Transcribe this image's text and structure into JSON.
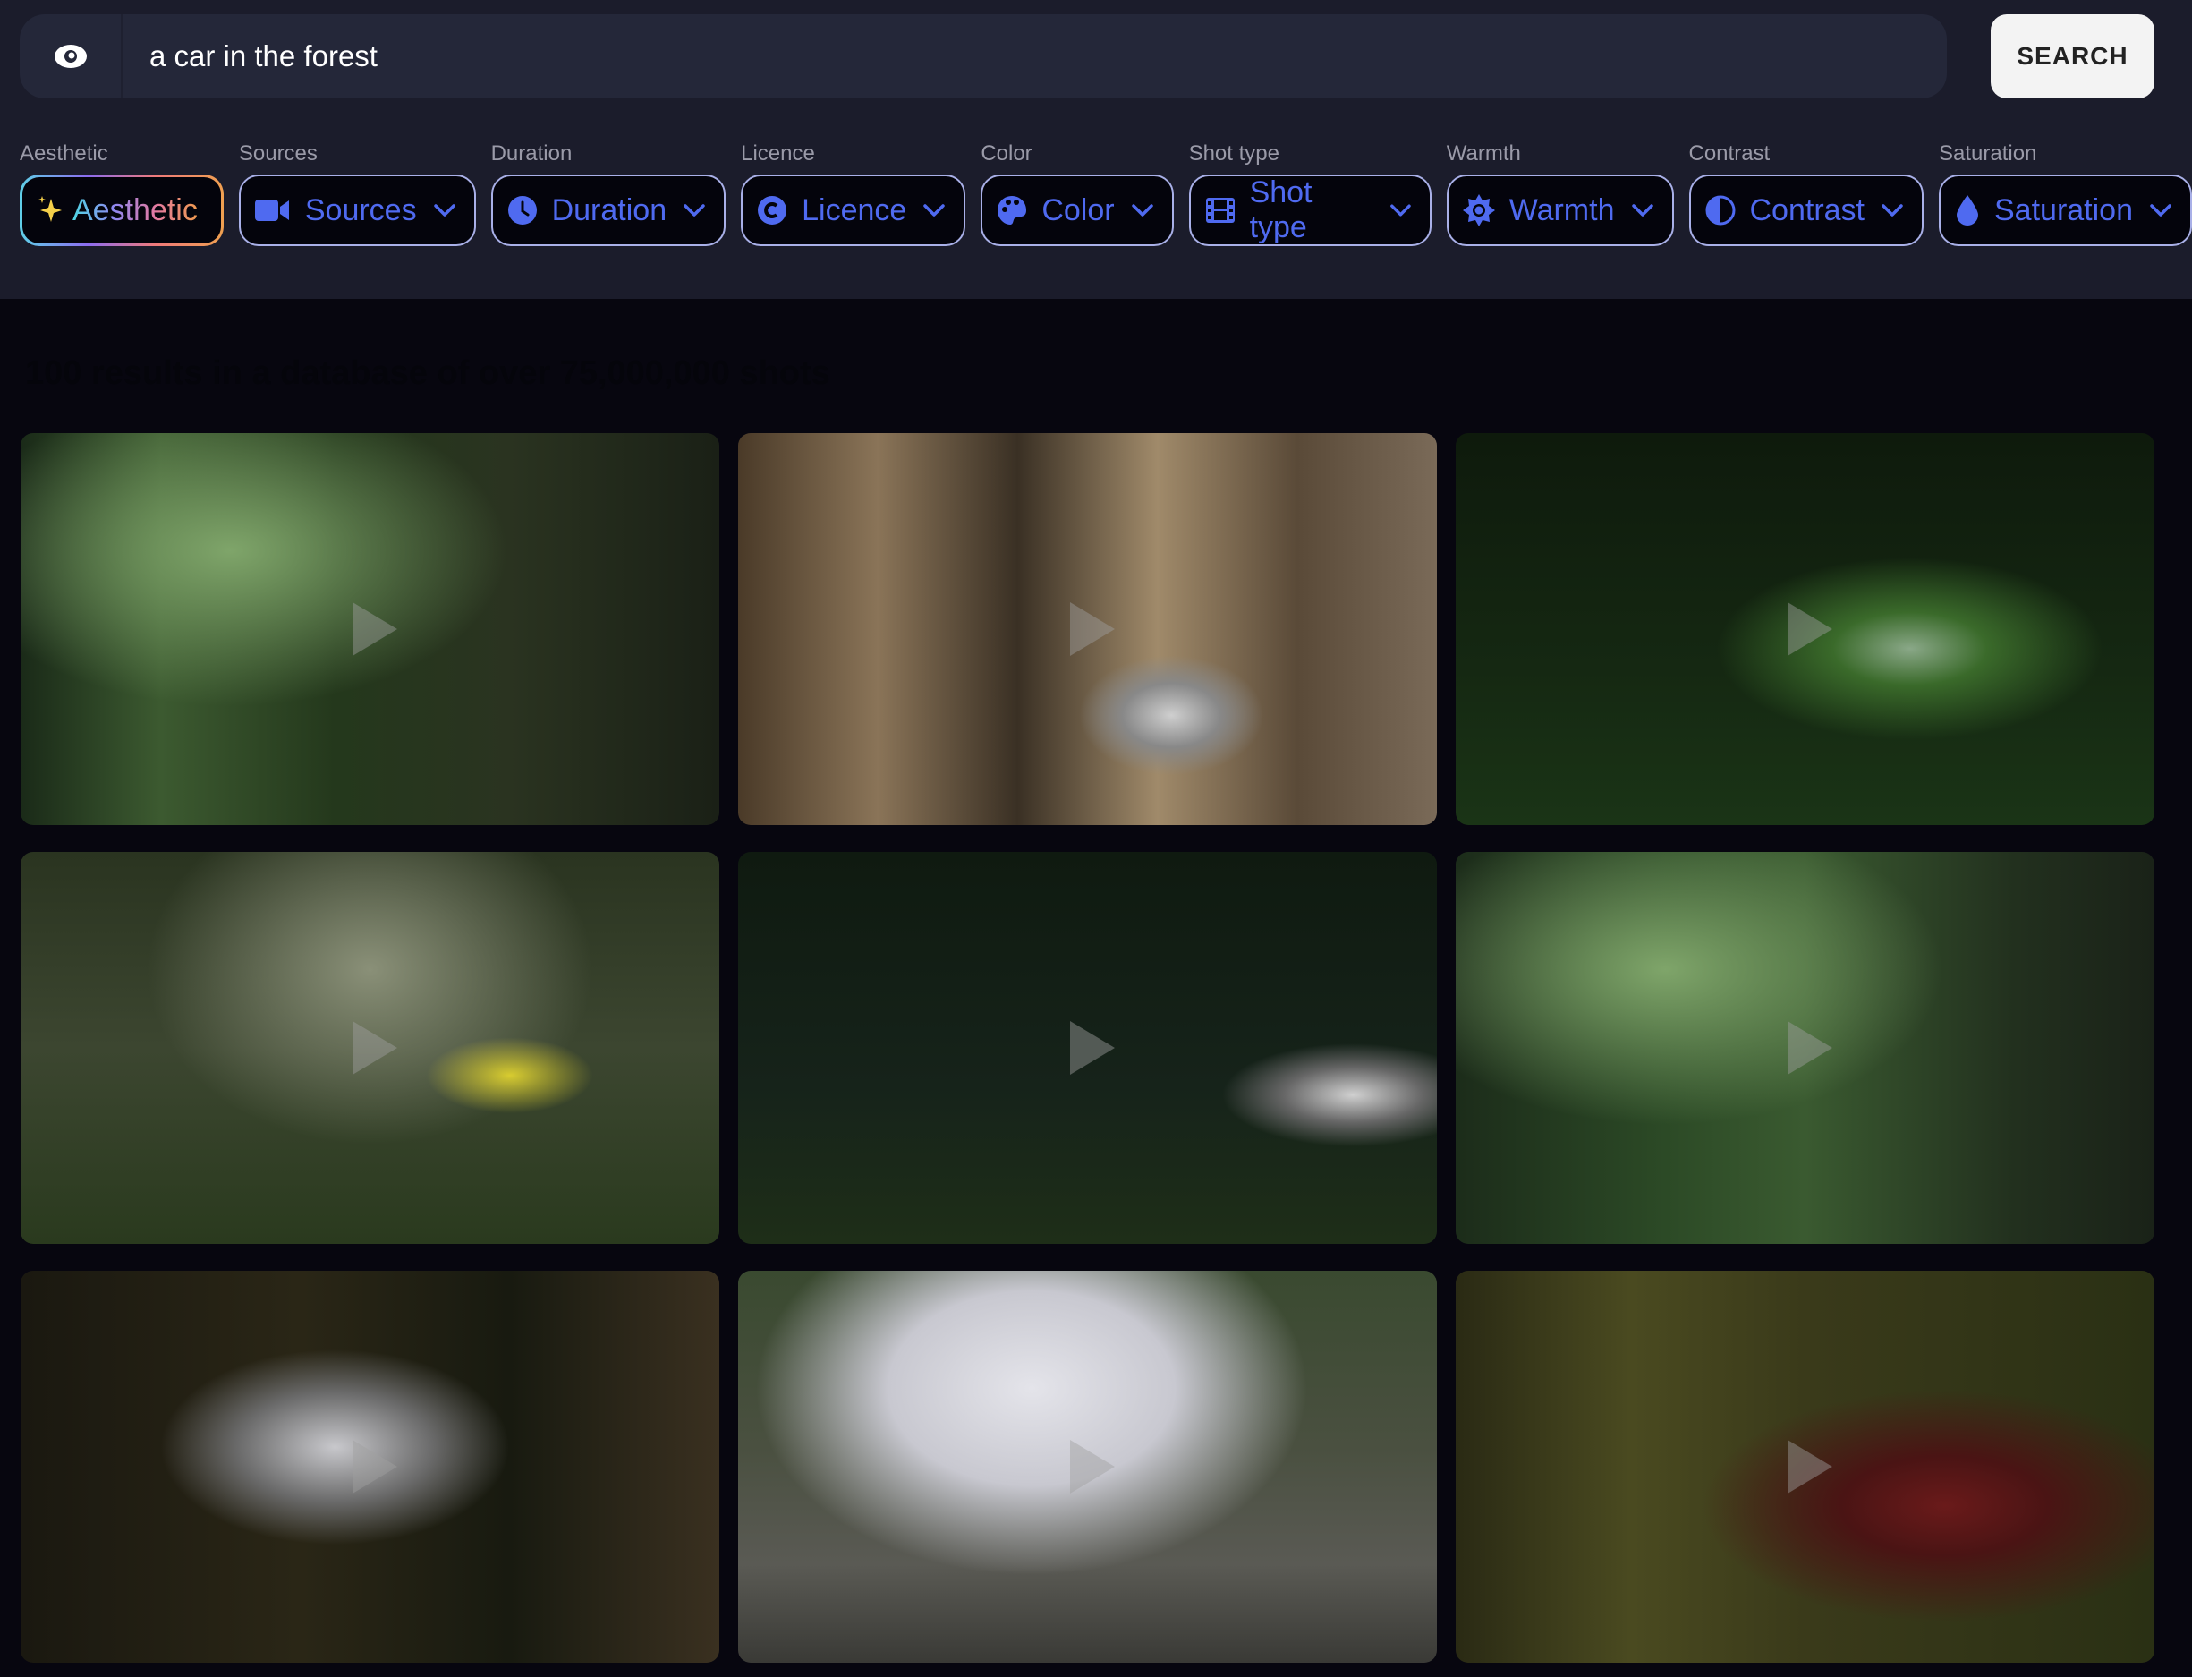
{
  "search": {
    "query": "a car in the forest",
    "button_label": "SEARCH",
    "icon": "eye-icon"
  },
  "filters": [
    {
      "label": "Aesthetic",
      "value": "Aesthetic",
      "icon": "sparkles-icon"
    },
    {
      "label": "Sources",
      "value": "Sources",
      "icon": "video-camera-icon"
    },
    {
      "label": "Duration",
      "value": "Duration",
      "icon": "clock-icon"
    },
    {
      "label": "Licence",
      "value": "Licence",
      "icon": "copyright-icon"
    },
    {
      "label": "Color",
      "value": "Color",
      "icon": "palette-icon"
    },
    {
      "label": "Shot type",
      "value": "Shot type",
      "icon": "film-icon"
    },
    {
      "label": "Warmth",
      "value": "Warmth",
      "icon": "sun-icon"
    },
    {
      "label": "Contrast",
      "value": "Contrast",
      "icon": "contrast-icon"
    },
    {
      "label": "Saturation",
      "value": "Saturation",
      "icon": "drop-icon"
    }
  ],
  "results_summary": "100 results in a database of over 75,000,000 shots",
  "colors": {
    "accent": "#4f6af0",
    "pill_border": "#a9b0e8",
    "header_bg": "#1b1c2b",
    "page_bg": "#07060f"
  },
  "results": [
    {
      "thumbnail": "abandoned car in sunlit forest",
      "icon": "play-icon"
    },
    {
      "thumbnail": "white car behind blurred trees",
      "icon": "play-icon"
    },
    {
      "thumbnail": "green-lit car in dark forest",
      "icon": "play-icon"
    },
    {
      "thumbnail": "yellow sports car on forest road",
      "icon": "play-icon"
    },
    {
      "thumbnail": "white sports car in dark forest",
      "icon": "play-icon"
    },
    {
      "thumbnail": "abandoned car among trees",
      "icon": "play-icon"
    },
    {
      "thumbnail": "white SUV among pine trees",
      "icon": "play-icon"
    },
    {
      "thumbnail": "white sedan on forest trail",
      "icon": "play-icon"
    },
    {
      "thumbnail": "red car in mossy forest",
      "icon": "play-icon"
    }
  ]
}
